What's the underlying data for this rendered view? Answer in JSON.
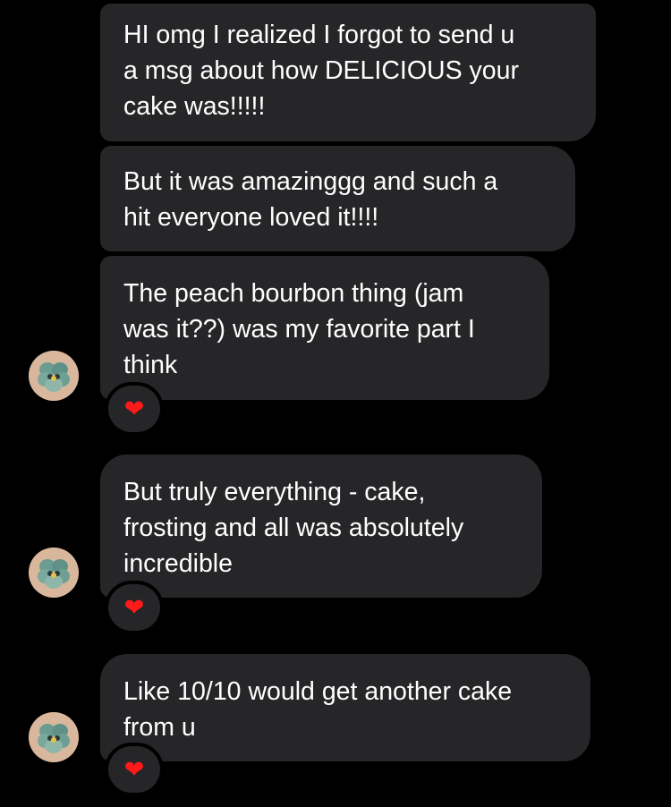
{
  "conversation": {
    "messages": [
      {
        "text": "HI omg I realized I forgot to send u\na msg about how DELICIOUS your\ncake was!!!!!"
      },
      {
        "text": "But it was amazinggg and such a\nhit everyone loved it!!!!"
      },
      {
        "text": "The peach bourbon thing (jam\nwas it??) was my favorite part I\nthink",
        "reaction": "❤"
      },
      {
        "text": "But truly everything - cake,\nfrosting and all was absolutely\nincredible",
        "reaction": "❤"
      },
      {
        "text": "Like 10/10 would get another cake\nfrom u",
        "reaction": "❤"
      }
    ]
  },
  "theme": {
    "background": "#000000",
    "bubble_color": "#262628",
    "text_color": "#ffffff",
    "heart_color": "#ff1a1a"
  },
  "icons": {
    "avatar": "pansy-flower-avatar-icon",
    "reaction": "red-heart-icon"
  }
}
